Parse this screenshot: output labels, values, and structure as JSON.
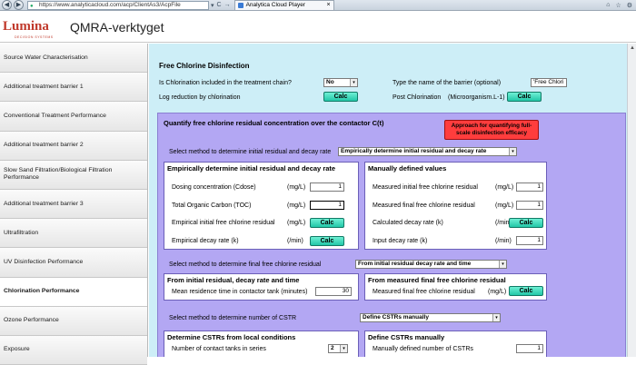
{
  "browser": {
    "url": "https://www.analyticacloud.com/acp/ClientAs3/AcpFile",
    "tab_title": "Analytica Cloud Player",
    "tab_close": "×",
    "nav_back": "◀",
    "nav_forward": "▶",
    "addr_ctrls": [
      "▾",
      "C",
      "→"
    ],
    "win_ctrls": [
      "⌂",
      "☆",
      "⚙"
    ]
  },
  "header": {
    "logo_text": "Lumina",
    "logo_sub": "DECISION SYSTEMS",
    "title": "QMRA-verktyget"
  },
  "sidebar": {
    "items": [
      {
        "label": "Source Water Characterisation"
      },
      {
        "label": "Additional treatment barrier 1"
      },
      {
        "label": "Conventional Treatment Performance"
      },
      {
        "label": "Additional treatment barrier 2"
      },
      {
        "label": "Slow Sand Filtration/Biological Filtration Performance"
      },
      {
        "label": "Additional treatment barrier 3"
      },
      {
        "label": "Ultrafiltration"
      },
      {
        "label": "UV Disinfection Performance"
      },
      {
        "label": "Chlorination Performance"
      },
      {
        "label": "Ozone Performance"
      },
      {
        "label": "Exposure"
      }
    ],
    "active_index": 8
  },
  "main": {
    "title": "Free Chlorine Disinfection",
    "chlorination_q": "Is Chlorination included in the treatment chain?",
    "chlorination_value": "No",
    "barrier_name_label": "Type the name of the barrier (optional)",
    "barrier_name_value": "'Free Chlori",
    "log_reduction_label": "Log reduction by chlorination",
    "post_chlorination_label": "Post Chlorination",
    "post_chlorination_unit": "(Microorganism.L-1)",
    "calc_label": "Calc",
    "quantify_title": "Quantify free chlorine residual concentration over the contactor C(t)",
    "approach_button": "Approach for quantifying full-scale disinfection efficacy",
    "method_residual_label": "Select method to determine initial residual and decay rate",
    "method_residual_value": "Empirically determine initial residual and decay rate",
    "empirical_box": {
      "title": "Empirically determine initial residual and decay rate",
      "rows": [
        {
          "label": "Dosing concentration (Cdose)",
          "unit": "(mg/L)",
          "value": "1"
        },
        {
          "label": "Total Organic Carbon (TOC)",
          "unit": "(mg/L)",
          "value": "1"
        },
        {
          "label": "Empirical initial free chlorine residual",
          "unit": "(mg/L)"
        },
        {
          "label": "Empirical decay rate (k)",
          "unit": "(/min)"
        }
      ]
    },
    "manual_box": {
      "title": "Manually defined values",
      "rows": [
        {
          "label": "Measured initial free chlorine residual",
          "unit": "(mg/L)",
          "value": "1"
        },
        {
          "label": "Measured final free chlorine residual",
          "unit": "(mg/L)",
          "value": "1"
        },
        {
          "label": "Calculated decay rate (k)",
          "unit": "(/min)"
        },
        {
          "label": "Input decay rate (k)",
          "unit": "(/min)",
          "value": "1"
        }
      ]
    },
    "method_final_label": "Select method to determine final free chlorine residual",
    "method_final_value": "From initial residual decay rate and time",
    "from_initial_box": {
      "title": "From initial residual, decay rate and time",
      "row_label": "Mean residence time in contactor tank (minutes)",
      "row_value": "30"
    },
    "from_measured_box": {
      "title": "From measured final free chlorine residual",
      "row_label": "Measured final free chlorine residual",
      "row_unit": "(mg/L)"
    },
    "method_cstr_label": "Select method to determine number of CSTR",
    "method_cstr_value": "Define CSTRs manually",
    "cstr_local_box": {
      "title": "Determine CSTRs from local conditions",
      "row_label": "Number of contact tanks in series",
      "row_value": "2"
    },
    "cstr_manual_box": {
      "title": "Define CSTRs manually",
      "row_label": "Manually defined number of CSTRs",
      "row_value": "1"
    },
    "dropdown_glyph": "▾",
    "scroll_up_glyph": "▲"
  }
}
